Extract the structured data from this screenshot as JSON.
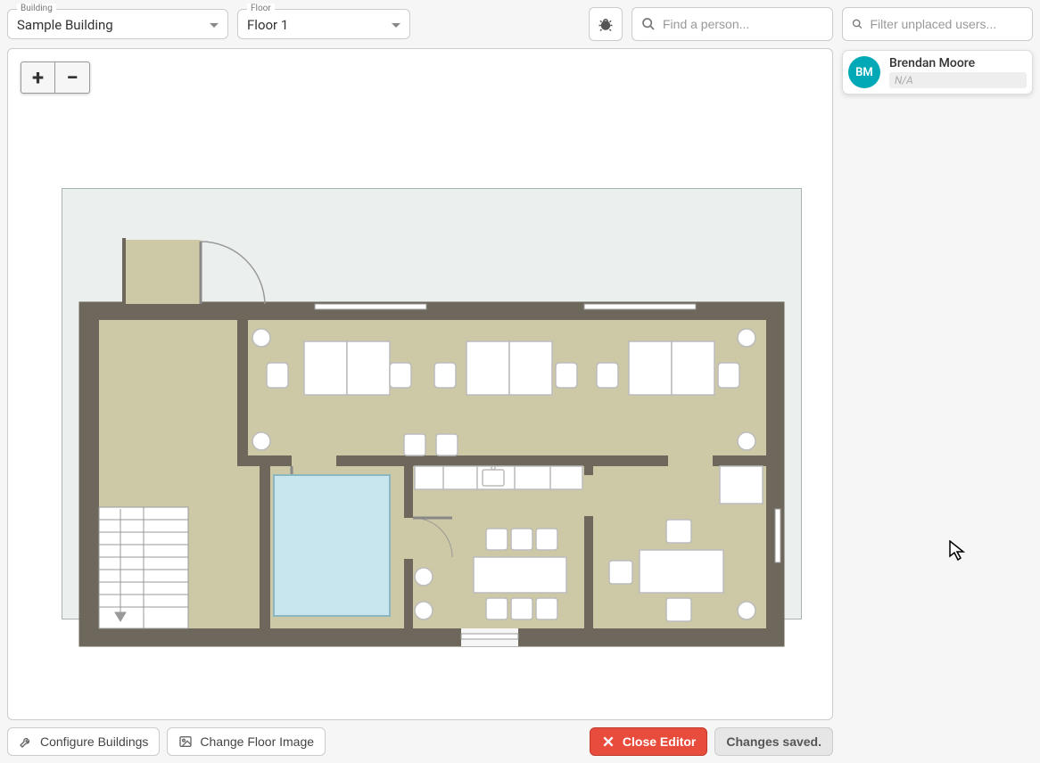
{
  "topbar": {
    "building": {
      "label": "Building",
      "value": "Sample Building"
    },
    "floor": {
      "label": "Floor",
      "value": "Floor 1"
    },
    "search_placeholder": "Find a person..."
  },
  "zoom": {
    "in": "+",
    "out": "−"
  },
  "bottombar": {
    "configure": "Configure Buildings",
    "change_image": "Change Floor Image",
    "close": "Close Editor",
    "status": "Changes saved."
  },
  "sidebar": {
    "filter_placeholder": "Filter unplaced users...",
    "users": [
      {
        "initials": "BM",
        "name": "Brendan Moore",
        "meta": "N/A"
      }
    ]
  },
  "colors": {
    "avatar": "#00a9b5",
    "danger": "#e74c3c"
  }
}
